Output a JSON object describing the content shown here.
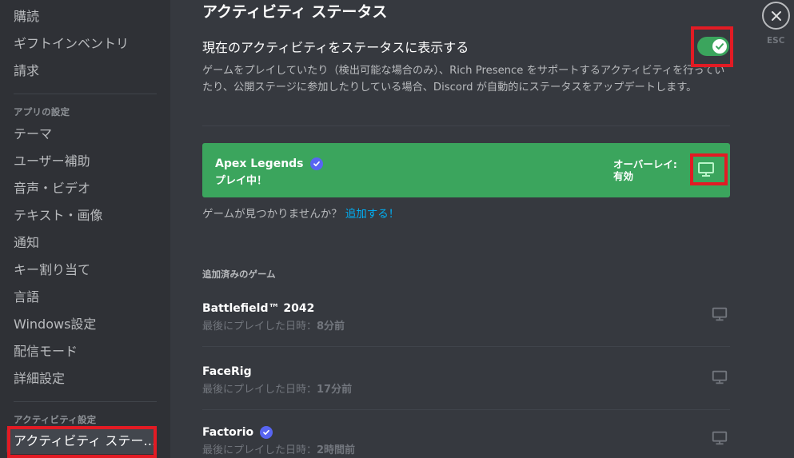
{
  "sidebar": {
    "items_top": [
      "購読",
      "ギフトインベントリ",
      "請求"
    ],
    "app_settings_header": "アプリの設定",
    "app_settings_items": [
      "テーマ",
      "ユーザー補助",
      "音声・ビデオ",
      "テキスト・画像",
      "通知",
      "キー割り当て",
      "言語",
      "Windows設定",
      "配信モード",
      "詳細設定"
    ],
    "activity_header": "アクティビティ設定",
    "activity_selected": "アクティビティ ステータス"
  },
  "main": {
    "title": "アクティビティ ステータス",
    "toggle_label": "現在のアクティビティをステータスに表示する",
    "toggle_on": true,
    "description": "ゲームをプレイしていたり（検出可能な場合のみ）、Rich Presence をサポートするアクティビティを行っていたり、公開ステージに参加したりしている場合、Discord が自動的にステータスをアップデートします。",
    "current_game": {
      "name": "Apex Legends",
      "status": "プレイ中！",
      "overlay_label": "オーバーレイ:",
      "overlay_value": "有効"
    },
    "not_found_text": "ゲームが見つかりませんか？",
    "add_link": "追加する！",
    "added_games_header": "追加済みのゲーム",
    "games": [
      {
        "name": "Battlefield™ 2042",
        "last_played_label": "最後にプレイした日時：",
        "last_played_value": "8分前",
        "verified": false
      },
      {
        "name": "FaceRig",
        "last_played_label": "最後にプレイした日時：",
        "last_played_value": "17分前",
        "verified": false
      },
      {
        "name": "Factorio",
        "last_played_label": "最後にプレイした日時：",
        "last_played_value": "2時間前",
        "verified": true
      }
    ]
  },
  "close": {
    "esc_label": "ESC"
  },
  "colors": {
    "green": "#3ba55d",
    "blurple": "#5865f2",
    "link": "#00aff4",
    "highlight": "#e21b24"
  }
}
